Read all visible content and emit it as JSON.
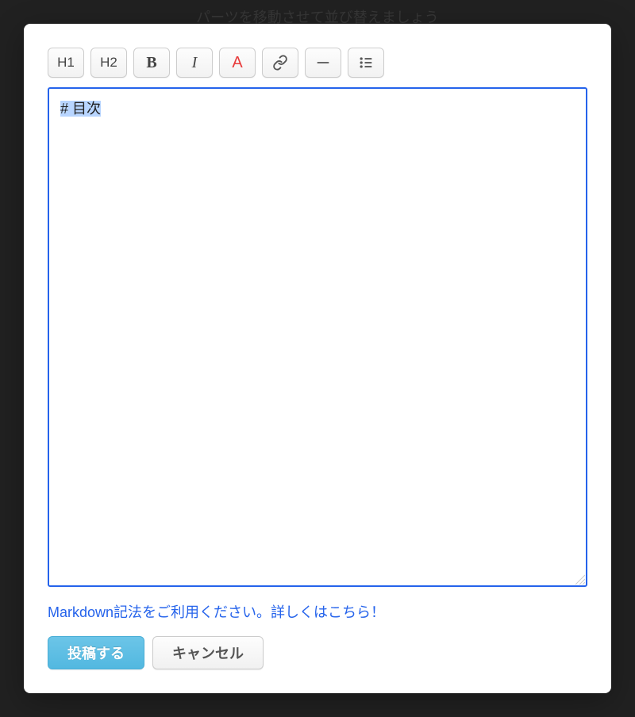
{
  "backdrop": {
    "hint_text": "パーツを移動させて並び替えましょう"
  },
  "toolbar": {
    "h1_label": "H1",
    "h2_label": "H2",
    "bold_label": "B",
    "italic_label": "I",
    "color_label": "A"
  },
  "editor": {
    "content": "# 目次"
  },
  "hint": {
    "text": "Markdown記法をご利用ください。詳しくはこちら！"
  },
  "actions": {
    "submit_label": "投稿する",
    "cancel_label": "キャンセル"
  }
}
